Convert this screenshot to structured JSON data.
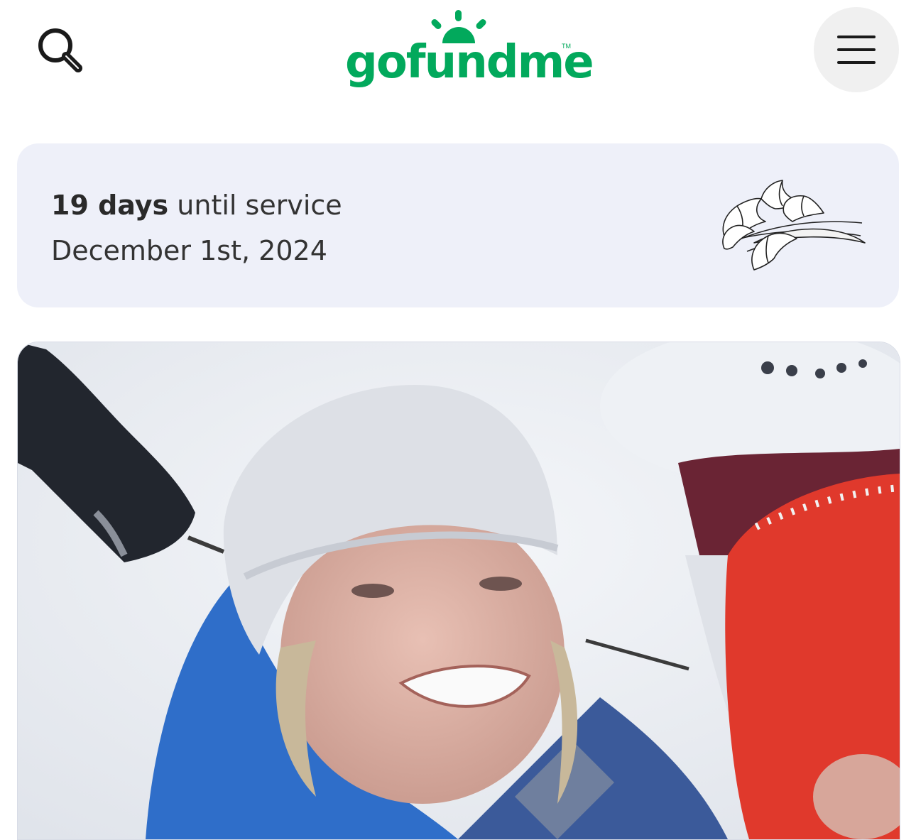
{
  "header": {
    "search_icon": "search-icon",
    "logo_text": "gofundme",
    "logo_tm": "TM",
    "menu_icon": "hamburger-menu-icon",
    "brand_color": "#02a95c"
  },
  "service": {
    "days": "19 days",
    "until_text": "until service",
    "date": "December 1st, 2024",
    "decoration_icon": "calla-lily-illustration",
    "card_background": "#eef0f9"
  },
  "photo": {
    "icon": "campaign-photo",
    "description_colors": [
      "#e8ecf2",
      "#2f6ec9",
      "#e0392c",
      "#22262e"
    ]
  }
}
